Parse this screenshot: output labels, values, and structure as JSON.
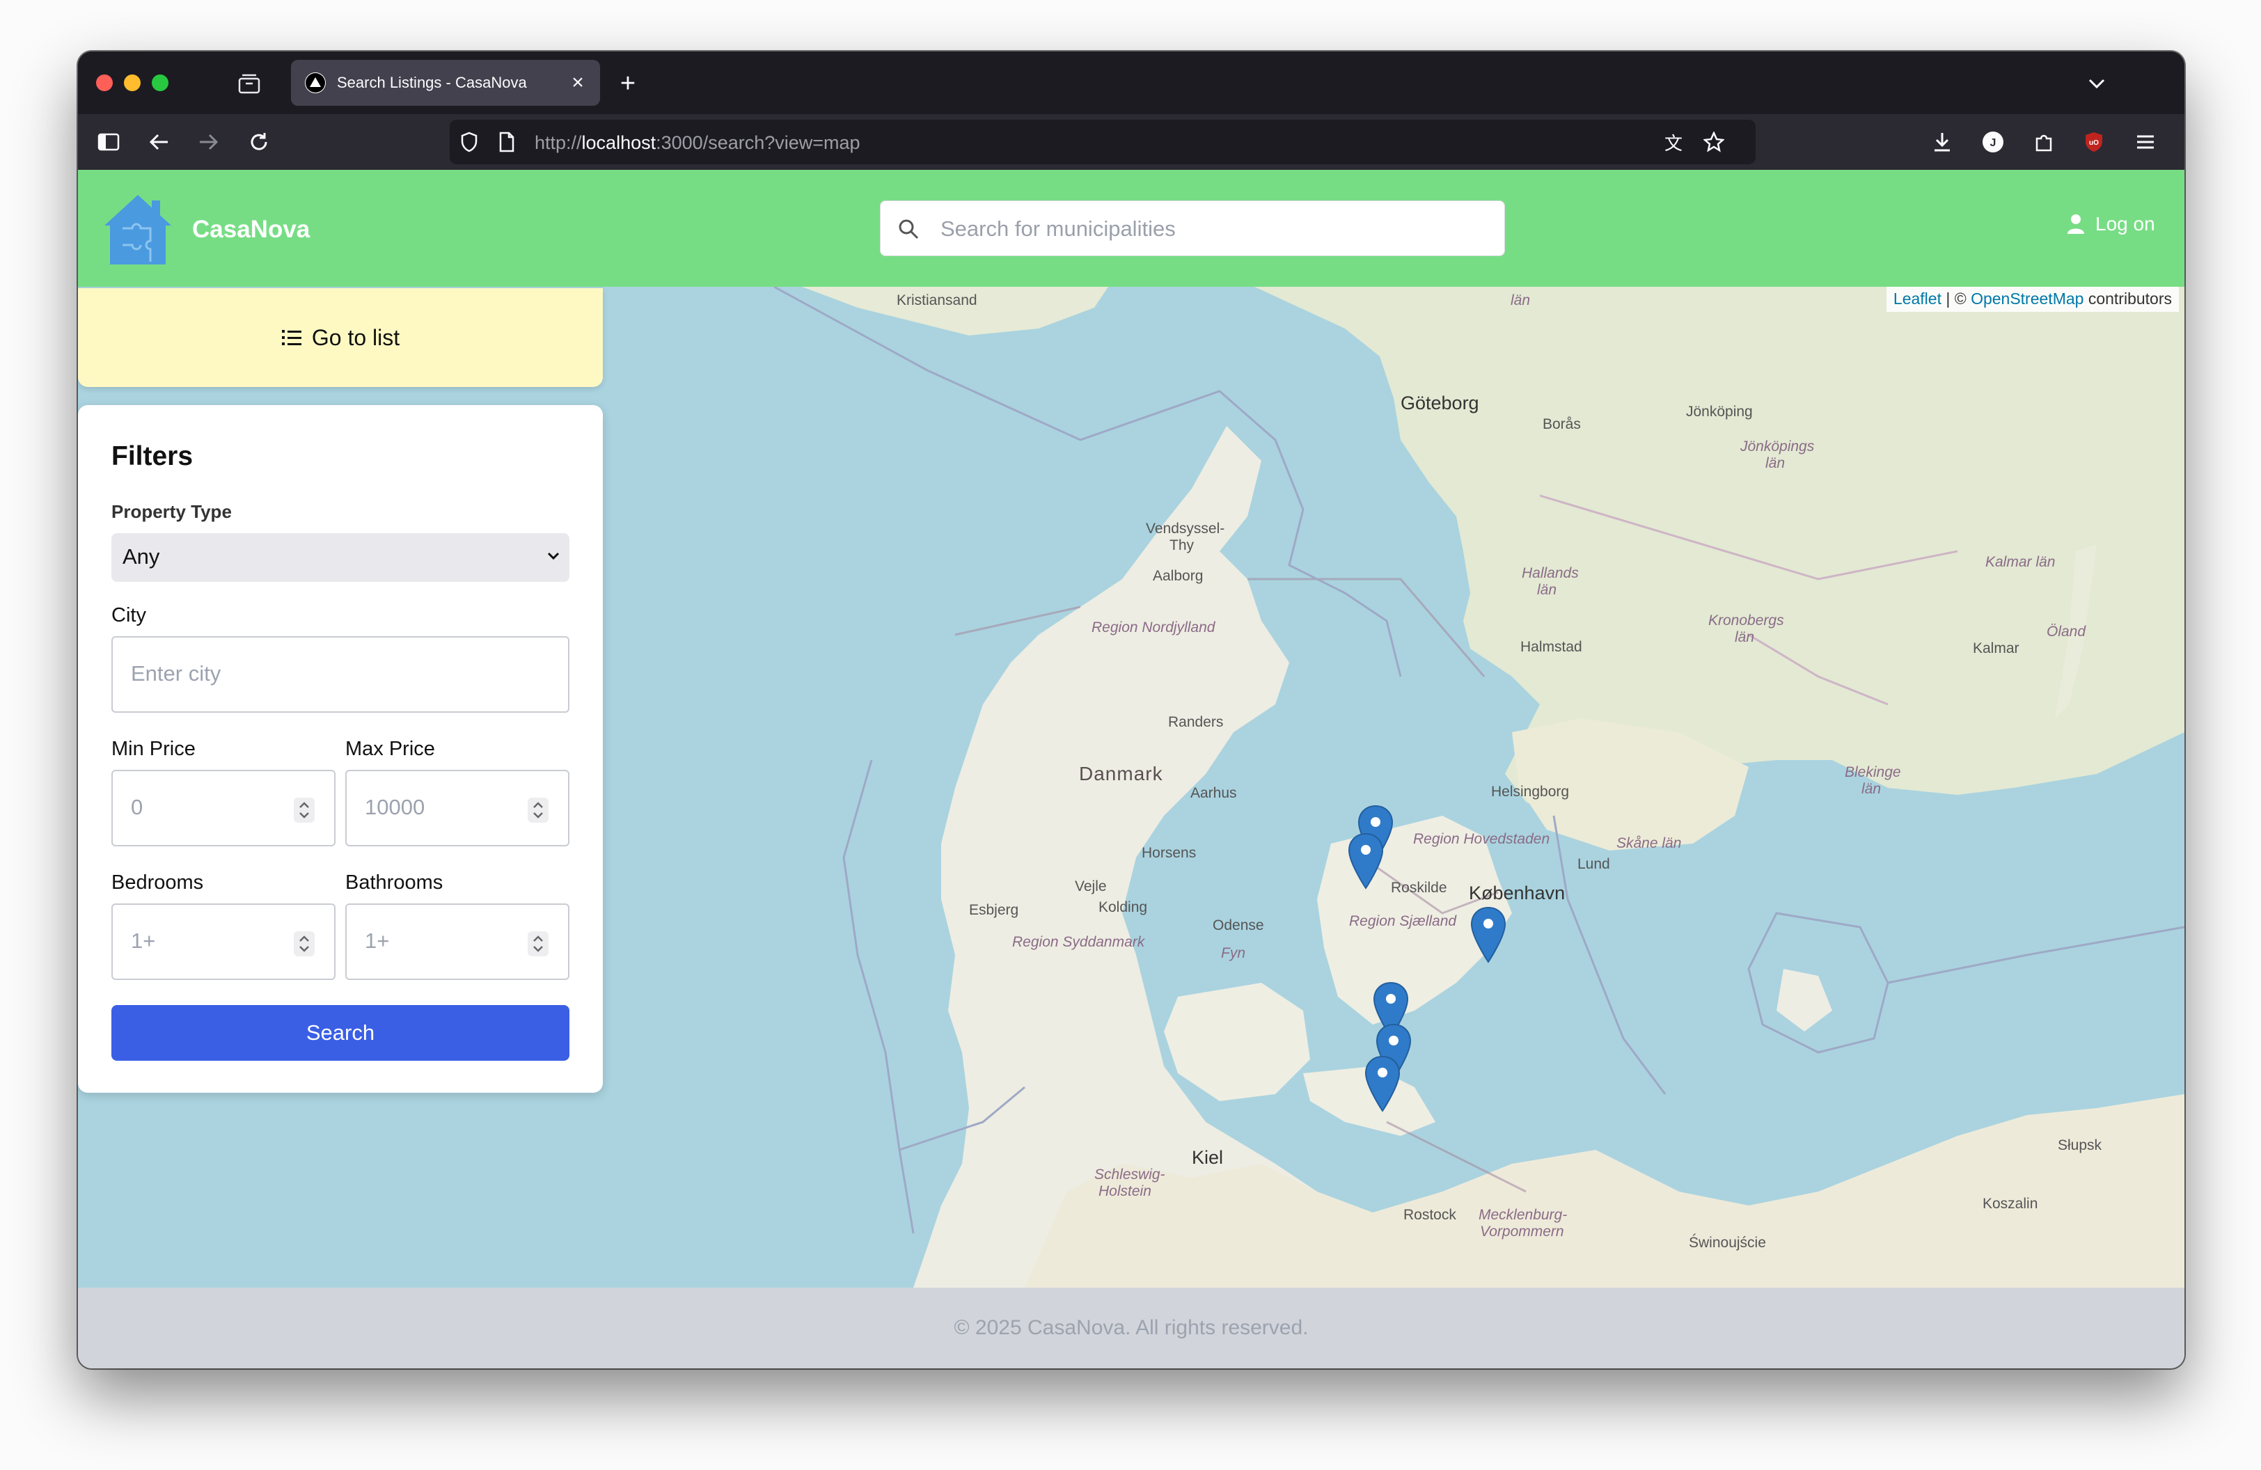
{
  "browser": {
    "tab_title": "Search Listings - CasaNova",
    "url_prefix": "http://",
    "url_host": "localhost",
    "url_rest": ":3000/search?view=map"
  },
  "header": {
    "brand": "CasaNova",
    "search_placeholder": "Search for municipalities",
    "login_label": "Log on"
  },
  "map": {
    "attribution_leaflet": "Leaflet",
    "attribution_sep": " | © ",
    "attribution_osm": "OpenStreetMap",
    "attribution_suffix": " contributors",
    "labels": {
      "kristiansand": "Kristiansand",
      "goteborg": "Göteborg",
      "boras": "Borås",
      "jonkoping": "Jönköping",
      "jonkopings_lan": "Jönköpings",
      "jonkopings_lan2": "län",
      "vastra_lan": "län",
      "vendsyssel": "Vendsyssel-",
      "vendsyssel2": "Thy",
      "aalborg": "Aalborg",
      "region_nordjylland": "Region Nordjylland",
      "hallands": "Hallands",
      "hallands2": "län",
      "halmstad": "Halmstad",
      "kronobergs": "Kronobergs",
      "kronobergs2": "län",
      "kalmar_lan": "Kalmar län",
      "kalmar": "Kalmar",
      "oland": "Öland",
      "randers": "Randers",
      "danmark": "Danmark",
      "aarhus": "Aarhus",
      "helsingborg": "Helsingborg",
      "blekinge": "Blekinge",
      "blekinge2": "län",
      "region_hovedstaden": "Region Hovedstaden",
      "skane": "Skåne län",
      "horsens": "Horsens",
      "lund": "Lund",
      "vejle": "Vejle",
      "roskilde": "Roskilde",
      "kobenhavn": "København",
      "esbjerg": "Esbjerg",
      "kolding": "Kolding",
      "odense": "Odense",
      "region_sjaelland": "Region Sjælland",
      "region_syddanmark": "Region Syddanmark",
      "fyn": "Fyn",
      "kiel": "Kiel",
      "schleswig": "Schleswig-",
      "schleswig2": "Holstein",
      "rostock": "Rostock",
      "mecklenburg": "Mecklenburg-",
      "mecklenburg2": "Vorpommern",
      "swinoujscie": "Świnoujście",
      "koszalin": "Koszalin",
      "slupsk": "Słupsk"
    }
  },
  "sidebar": {
    "go_to_list": "Go to list",
    "filters_title": "Filters",
    "property_type_label": "Property Type",
    "property_type_value": "Any",
    "city_label": "City",
    "city_placeholder": "Enter city",
    "min_price_label": "Min Price",
    "min_price_placeholder": "0",
    "max_price_label": "Max Price",
    "max_price_placeholder": "10000",
    "bedrooms_label": "Bedrooms",
    "bedrooms_placeholder": "1+",
    "bathrooms_label": "Bathrooms",
    "bathrooms_placeholder": "1+",
    "search_button": "Search"
  },
  "footer": {
    "text": "© 2025 CasaNova. All rights reserved."
  },
  "colors": {
    "header_green": "#77dd85",
    "search_button": "#3a5fe5",
    "go_list_bg": "#fef9c3",
    "water": "#aad3df",
    "land": "#f2efe9",
    "marker": "#2f7bc9"
  }
}
